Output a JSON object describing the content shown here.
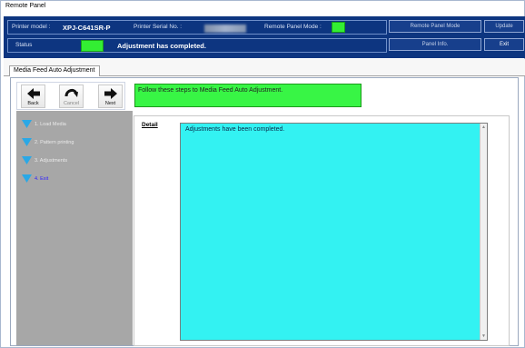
{
  "window": {
    "title": "Remote Panel"
  },
  "header": {
    "printer_model_label": "Printer model :",
    "printer_model_value": "XPJ-C641SR-P",
    "serial_label": "Printer Serial No. :",
    "remote_mode_label": "Remote Panel Mode :",
    "remote_panel_mode_button": "Remote Panel Mode",
    "update_button": "Update",
    "status_label": "Status",
    "status_text": "Adjustment has completed.",
    "panel_info_button": "Panel Info.",
    "exit_button": "Exit"
  },
  "tabs": [
    {
      "label": "Media Feed Auto Adjustment"
    }
  ],
  "toolbar": {
    "back": "Back",
    "cancel": "Cancel",
    "next": "Next"
  },
  "steps": [
    {
      "label": "1. Load Media"
    },
    {
      "label": "2. Pattern printing"
    },
    {
      "label": "3. Adjustments"
    },
    {
      "label": "4. Exit"
    }
  ],
  "instruction": "Follow these steps to Media Feed Auto Adjustment.",
  "detail": {
    "label": "Detail",
    "text": "Adjustments have been completed."
  },
  "colors": {
    "header_bg": "#0d3580",
    "status_ok": "#33ee33",
    "instruction_bg": "#38f545",
    "detail_bg": "#33f2f2",
    "step_panel_bg": "#a7a7a7",
    "current_step": "#3322ff",
    "step_icon": "#2aa8e6"
  },
  "icons": {
    "back": "arrow-left-icon",
    "cancel": "undo-curve-icon",
    "next": "arrow-right-icon",
    "step": "triangle-down-icon"
  }
}
